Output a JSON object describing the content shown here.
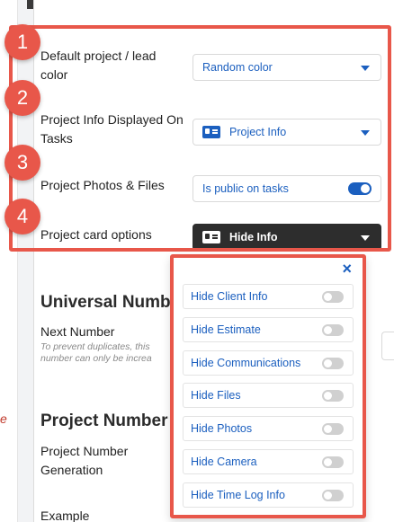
{
  "settings": {
    "default_color": {
      "label": "Default project / lead color",
      "value": "Random color"
    },
    "info_on_tasks": {
      "label": "Project Info Displayed On Tasks",
      "value": "Project Info"
    },
    "photos_files": {
      "label": "Project Photos & Files",
      "value": "Is public on tasks",
      "toggle_on": true
    },
    "card_options": {
      "label": "Project card options",
      "value": "Hide Info"
    }
  },
  "badges": [
    "1",
    "2",
    "3",
    "4"
  ],
  "universal": {
    "title": "Universal Numb",
    "next_number_label": "Next Number",
    "hint": "To prevent duplicates, this number can only be increa"
  },
  "project_number": {
    "title": "Project Number",
    "generation_label": "Project Number Generation",
    "example_label": "Example"
  },
  "background": {
    "left_fragment": "e"
  },
  "popover": {
    "close": "×",
    "options": [
      {
        "label": "Hide Client Info",
        "on": false
      },
      {
        "label": "Hide Estimate",
        "on": false
      },
      {
        "label": "Hide Communications",
        "on": false
      },
      {
        "label": "Hide Files",
        "on": false
      },
      {
        "label": "Hide Photos",
        "on": false
      },
      {
        "label": "Hide Camera",
        "on": false
      },
      {
        "label": "Hide Time Log Info",
        "on": false
      }
    ]
  },
  "colors": {
    "accent": "#1b5fbf",
    "highlight": "#e8574a",
    "dark_select": "#2d2d2d"
  }
}
